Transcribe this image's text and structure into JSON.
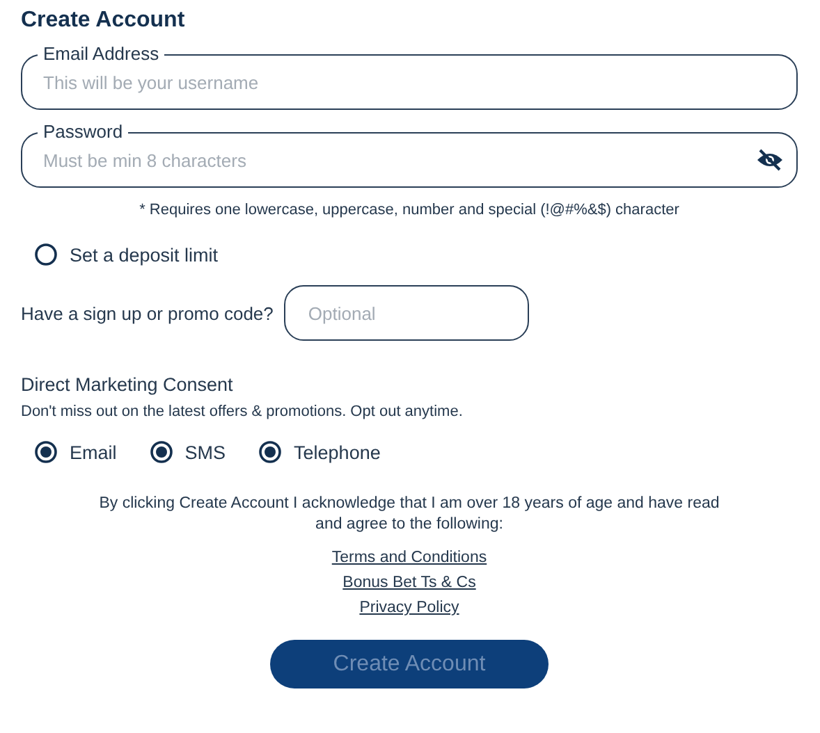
{
  "title": "Create Account",
  "fields": [
    {
      "label": "Email Address",
      "placeholder": "This will be your username",
      "kind": "text"
    },
    {
      "label": "Password",
      "placeholder": "Must be min 8 characters",
      "kind": "password"
    }
  ],
  "password_note": "* Requires one lowercase, uppercase, number and special (!@#%&$) character",
  "deposit_limit": {
    "label": "Set a deposit limit",
    "selected": false
  },
  "promo": {
    "label": "Have a sign up or promo code?",
    "placeholder": "Optional"
  },
  "marketing": {
    "title": "Direct Marketing Consent",
    "subtitle": "Don't miss out on the latest offers & promotions. Opt out anytime.",
    "options": [
      {
        "label": "Email",
        "selected": true
      },
      {
        "label": "SMS",
        "selected": true
      },
      {
        "label": "Telephone",
        "selected": true
      }
    ]
  },
  "legal_text": "By clicking Create Account I acknowledge that I am over 18 years of age and have read and agree to the following:",
  "links": [
    "Terms and Conditions",
    "Bonus Bet Ts & Cs",
    "Privacy Policy"
  ],
  "submit": {
    "label": "Create Account",
    "disabled": true
  }
}
